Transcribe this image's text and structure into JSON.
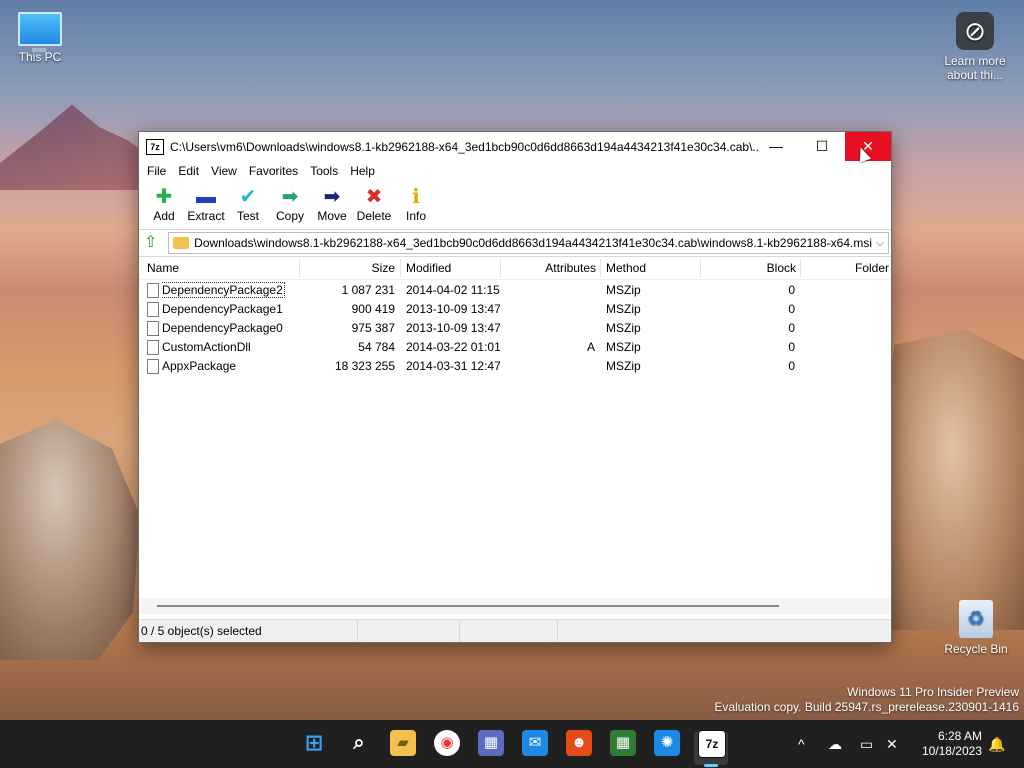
{
  "desktop": {
    "icons": [
      {
        "label": "This PC"
      },
      {
        "label": "Learn more about thi..."
      },
      {
        "label": "Recycle Bin"
      }
    ],
    "watermark": {
      "line1": "Windows 11 Pro Insider Preview",
      "line2": "Evaluation copy. Build 25947.rs_prerelease.230901-1416"
    }
  },
  "window": {
    "app_icon": "7z",
    "title": "C:\\Users\\vm6\\Downloads\\windows8.1-kb2962188-x64_3ed1bcb90c0d6dd8663d194a4434213f41e30c34.cab\\...",
    "controls": {
      "minimize": "—",
      "maximize": "☐",
      "close": "✕"
    },
    "menu": [
      "File",
      "Edit",
      "View",
      "Favorites",
      "Tools",
      "Help"
    ],
    "toolbar": [
      {
        "label": "Add",
        "icon": "plus-icon",
        "glyph": "✚",
        "color": "#22b14c"
      },
      {
        "label": "Extract",
        "icon": "minus-icon",
        "glyph": "▬",
        "color": "#1f3fbf"
      },
      {
        "label": "Test",
        "icon": "check-icon",
        "glyph": "✔",
        "color": "#27b3c7"
      },
      {
        "label": "Copy",
        "icon": "copy-arrow-icon",
        "glyph": "➡",
        "color": "#2e9a7e"
      },
      {
        "label": "Move",
        "icon": "move-arrow-icon",
        "glyph": "➡",
        "color": "#1a237e"
      },
      {
        "label": "Delete",
        "icon": "delete-x-icon",
        "glyph": "✖",
        "color": "#d32f2f"
      },
      {
        "label": "Info",
        "icon": "info-icon",
        "glyph": "ℹ",
        "color": "#e0a800"
      }
    ],
    "address": "C:\\Users\\vm6\\Downloads\\windows8.1-kb2962188-x64_3ed1bcb90c0d6dd8663d194a4434213f41e30c34.cab\\windows8.1-kb2962188-x64.msi\\",
    "columns": {
      "name": "Name",
      "size": "Size",
      "modified": "Modified",
      "attributes": "Attributes",
      "method": "Method",
      "block": "Block",
      "folder": "Folder"
    },
    "files": [
      {
        "name": "DependencyPackage2",
        "size": "1 087 231",
        "modified": "2014-04-02 11:15",
        "attributes": "",
        "method": "MSZip",
        "block": "0"
      },
      {
        "name": "DependencyPackage1",
        "size": "900 419",
        "modified": "2013-10-09 13:47",
        "attributes": "",
        "method": "MSZip",
        "block": "0"
      },
      {
        "name": "DependencyPackage0",
        "size": "975 387",
        "modified": "2013-10-09 13:47",
        "attributes": "",
        "method": "MSZip",
        "block": "0"
      },
      {
        "name": "CustomActionDll",
        "size": "54 784",
        "modified": "2014-03-22 01:01",
        "attributes": "A",
        "method": "MSZip",
        "block": "0"
      },
      {
        "name": "AppxPackage",
        "size": "18 323 255",
        "modified": "2014-03-31 12:47",
        "attributes": "",
        "method": "MSZip",
        "block": "0"
      }
    ],
    "status": "0 / 5 object(s) selected"
  },
  "taskbar": {
    "apps": [
      {
        "name": "start-button",
        "glyph": "⊞",
        "color": "#3aa0f0"
      },
      {
        "name": "search-button",
        "glyph": "⌕",
        "color": "#ffffff"
      },
      {
        "name": "file-explorer-icon",
        "glyph": "▰",
        "color": "#f2c14e"
      },
      {
        "name": "chrome-icon",
        "glyph": "◉",
        "color": "#e53935"
      },
      {
        "name": "calendar-app-icon",
        "glyph": "▦",
        "color": "#5c6bc0"
      },
      {
        "name": "mail-app-icon",
        "glyph": "✉",
        "color": "#1e88e5"
      },
      {
        "name": "people-app-icon",
        "glyph": "👥",
        "color": "#e64a19"
      },
      {
        "name": "calculator-app-icon",
        "glyph": "▦",
        "color": "#2e7d32"
      },
      {
        "name": "weather-app-icon",
        "glyph": "✺",
        "color": "#1e88e5"
      },
      {
        "name": "7zip-taskbar-icon",
        "glyph": "7z",
        "color": "#111111"
      }
    ],
    "tray": {
      "chevron": "^",
      "cloud": "☁",
      "network": "▭",
      "volume": "🔇",
      "bell": "🔔"
    },
    "time": "6:28 AM",
    "date": "10/18/2023"
  }
}
